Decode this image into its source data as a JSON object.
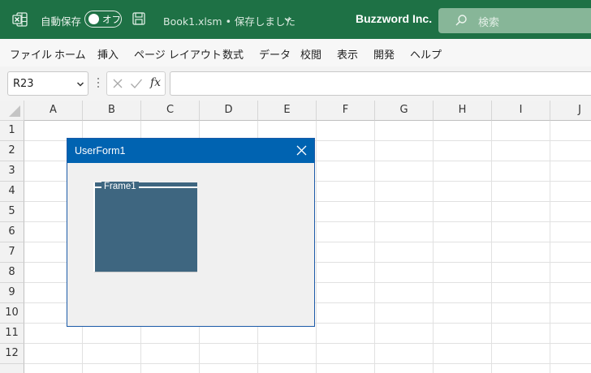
{
  "titlebar": {
    "autosave_label": "自動保存",
    "autosave_state": "オフ",
    "filename": "Book1.xlsm • 保存しました",
    "company": "Buzzword Inc.",
    "search_placeholder": "検索"
  },
  "menu": {
    "items": [
      "ファイル",
      "ホーム",
      "挿入",
      "ページ レイアウト",
      "数式",
      "データ",
      "校閲",
      "表示",
      "開発",
      "ヘルプ"
    ]
  },
  "formula_bar": {
    "name_box": "R23",
    "fx_label": "fx",
    "formula": ""
  },
  "grid": {
    "columns": [
      "A",
      "B",
      "C",
      "D",
      "E",
      "F",
      "G",
      "H",
      "I",
      "J"
    ],
    "rows": [
      "1",
      "2",
      "3",
      "4",
      "5",
      "6",
      "7",
      "8",
      "9",
      "10",
      "11",
      "12"
    ]
  },
  "userform": {
    "title": "UserForm1",
    "frame_caption": "Frame1",
    "frame_color": "#3e6680",
    "title_color": "#0063b1"
  },
  "colors": {
    "titlebar": "#1e7145"
  },
  "icons": {
    "app": "excel-icon",
    "save": "save-icon",
    "search": "search-icon",
    "close": "close-icon"
  }
}
